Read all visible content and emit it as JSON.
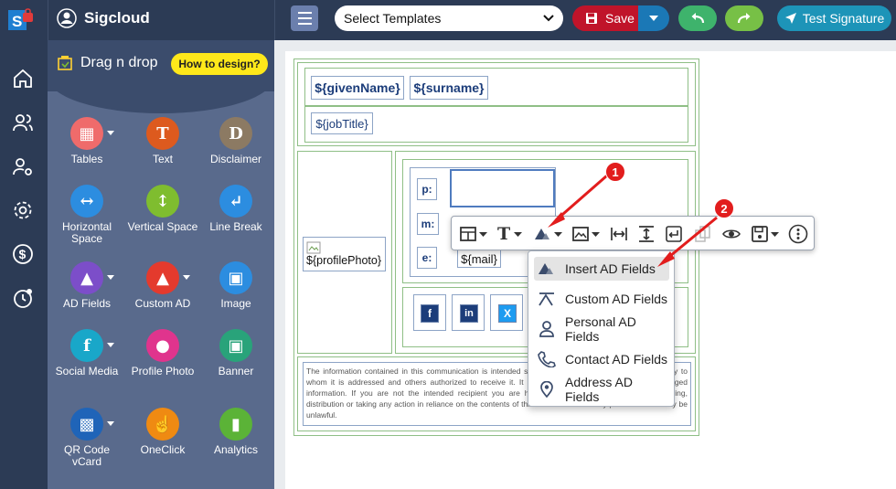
{
  "app": {
    "name": "Sigcloud",
    "logo_icon": "sigcloud-logo-icon"
  },
  "toolbar": {
    "template_select": "Select Templates",
    "save_label": "Save",
    "test_label": "Test Signature"
  },
  "colors": {
    "topbar": "#2c3b55",
    "save": "#c0142a",
    "undo": "#3eb36c",
    "redo": "#77c046",
    "test": "#1d94b8",
    "how_btn": "#ffe81a",
    "annotation": "#e21d1d"
  },
  "panel": {
    "title": "Drag n drop",
    "how_label": "How to design?",
    "tools": [
      {
        "label": "Tables",
        "icon": "tables-icon",
        "glyph": "▦",
        "color": "#ef6b6b"
      },
      {
        "label": "Text",
        "icon": "text-icon",
        "glyph": "T",
        "color": "#dd5a1e"
      },
      {
        "label": "Disclaimer",
        "icon": "disclaimer-icon",
        "glyph": "D",
        "color": "#8c7a63"
      },
      {
        "label": "Horizontal Space",
        "icon": "horizontal-space-icon",
        "glyph": "↔",
        "color": "#2c8de0"
      },
      {
        "label": "Vertical Space",
        "icon": "vertical-space-icon",
        "glyph": "↕",
        "color": "#7fbd2f"
      },
      {
        "label": "Line Break",
        "icon": "line-break-icon",
        "glyph": "↵",
        "color": "#2c8de0"
      },
      {
        "label": "AD Fields",
        "icon": "ad-fields-icon",
        "glyph": "▲",
        "color": "#7c4ec9"
      },
      {
        "label": "Custom AD",
        "icon": "custom-ad-icon",
        "glyph": "▲",
        "color": "#e43a2d"
      },
      {
        "label": "Image",
        "icon": "image-icon",
        "glyph": "▣",
        "color": "#2c8de0"
      },
      {
        "label": "Social Media",
        "icon": "social-media-icon",
        "glyph": "f",
        "color": "#19a7c9"
      },
      {
        "label": "Profile Photo",
        "icon": "profile-photo-icon",
        "glyph": "●",
        "color": "#e0348d"
      },
      {
        "label": "Banner",
        "icon": "banner-icon",
        "glyph": "▣",
        "color": "#29a37a"
      },
      {
        "label": "QR Code vCard",
        "icon": "qr-code-icon",
        "glyph": "▩",
        "color": "#1f64b8"
      },
      {
        "label": "OneClick",
        "icon": "oneclick-icon",
        "glyph": "☝",
        "color": "#ef8a12"
      },
      {
        "label": "Analytics",
        "icon": "analytics-icon",
        "glyph": "▮",
        "color": "#5bb337"
      }
    ]
  },
  "signature": {
    "given_name": "${givenName}",
    "surname": "${surname}",
    "job_title": "${jobTitle}",
    "profile_photo": "${profilePhoto}",
    "phone_label": "p:",
    "mobile_label": "m:",
    "email_label": "e:",
    "mail": "${mail}",
    "social": [
      "f",
      "in",
      "X"
    ],
    "disclaimer": "The information contained in this communication is intended solely for the use of the individual or entity to whom it is addressed and others authorized to receive it. It may contain confidential or legally privileged information. If you are not the intended recipient you are hereby notified that any disclosure, copying, distribution or taking any action in reliance on the contents of this information is strictly prohibited and may be unlawful."
  },
  "dropdown": {
    "items": [
      {
        "label": "Insert AD Fields",
        "icon": "insert-ad-icon",
        "active": true
      },
      {
        "label": "Custom AD Fields",
        "icon": "custom-ad-fields-icon",
        "active": false
      },
      {
        "label": "Personal AD Fields",
        "icon": "person-icon",
        "active": false
      },
      {
        "label": "Contact AD Fields",
        "icon": "phone-icon",
        "active": false
      },
      {
        "label": "Address AD Fields",
        "icon": "location-pin-icon",
        "active": false
      }
    ]
  },
  "annotations": {
    "one": "1",
    "two": "2"
  }
}
